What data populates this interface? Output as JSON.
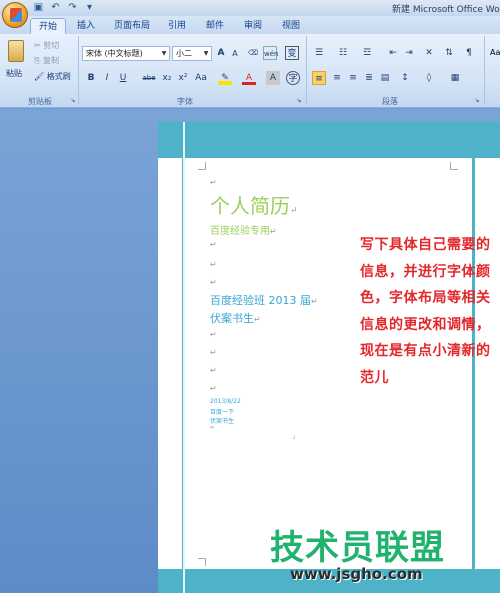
{
  "window": {
    "title": "新建 Microsoft Office Wo"
  },
  "tabs": [
    "开始",
    "插入",
    "页面布局",
    "引用",
    "邮件",
    "审阅",
    "视图"
  ],
  "clipboard": {
    "paste_label": "粘贴",
    "cut_label": "剪切",
    "copy_label": "复制",
    "format_painter_label": "格式刷",
    "group_label": "剪贴板"
  },
  "font": {
    "font_name": "宋体 (中文标题)",
    "font_size": "小二",
    "group_label": "字体",
    "bold": "B",
    "italic": "I",
    "underline": "U",
    "strike": "abe",
    "subscript": "x₂",
    "superscript": "x²",
    "change_case": "Aa",
    "grow": "A",
    "shrink": "A",
    "pinyin": "wén",
    "border_char": "变",
    "char_shade": "A",
    "enclose": "字"
  },
  "paragraph": {
    "group_label": "段落"
  },
  "styles": {
    "preview": "Aa"
  },
  "document": {
    "para_mark": "↵",
    "title": "个人简历",
    "subtitle": "百度经验专用",
    "class_line": "百度经验班 2013 届",
    "name_line": "伏案书生",
    "date_line": "2013/8/22",
    "small_line_1": "百度一下",
    "small_line_2": "伏案书生"
  },
  "annotation": "写下具体自己需要的信息，并进行字体颜色，字体布局等相关信息的更改和调情，现在是有点小清新的范儿",
  "watermark": {
    "text": "技术员联盟",
    "url": "www.jsgho.com"
  },
  "colors": {
    "accent_band": "#4eb3c9",
    "title_green": "#9ccf5a",
    "body_blue": "#3aa6d6",
    "annotation_red": "#e3282c",
    "watermark_green": "#1fb36e"
  }
}
